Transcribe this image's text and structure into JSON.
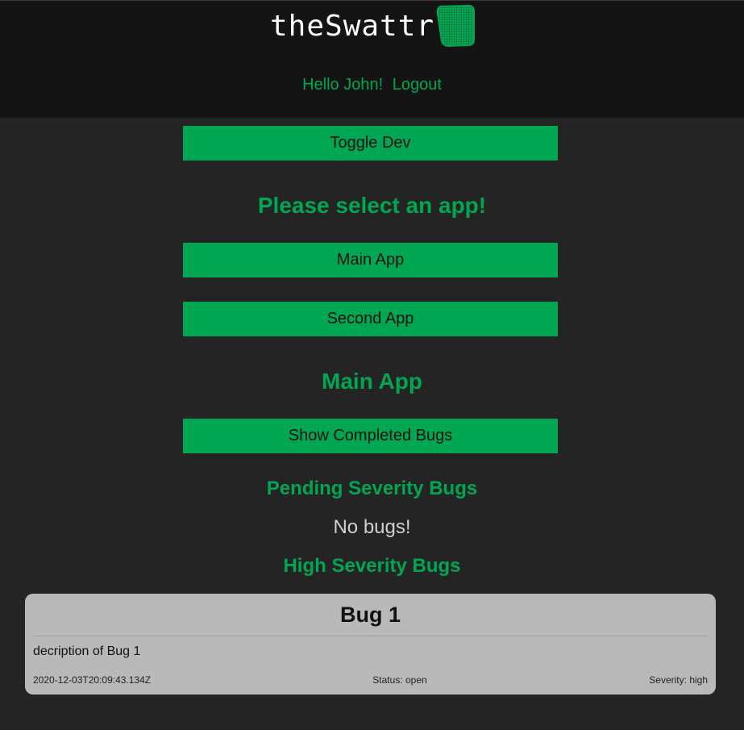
{
  "header": {
    "logo_text": "theSwattr",
    "logo_icon": "swatter-icon",
    "greeting": "Hello John!",
    "logout_label": "Logout"
  },
  "main": {
    "toggle_dev_label": "Toggle Dev",
    "select_app_heading": "Please select an app!",
    "apps": [
      {
        "label": "Main App"
      },
      {
        "label": "Second App"
      }
    ],
    "current_app_heading": "Main App",
    "show_completed_label": "Show Completed Bugs",
    "sections": [
      {
        "heading": "Pending Severity Bugs",
        "empty_text": "No bugs!"
      },
      {
        "heading": "High Severity Bugs"
      }
    ],
    "bugs": [
      {
        "title": "Bug 1",
        "description": "decription of Bug 1",
        "timestamp": "2020-12-03T20:09:43.134Z",
        "status": "Status: open",
        "severity": "Severity: high"
      }
    ]
  },
  "colors": {
    "accent": "#00a651",
    "background": "#242424",
    "header_bg": "#141414",
    "card_bg": "#b9b9b9"
  }
}
